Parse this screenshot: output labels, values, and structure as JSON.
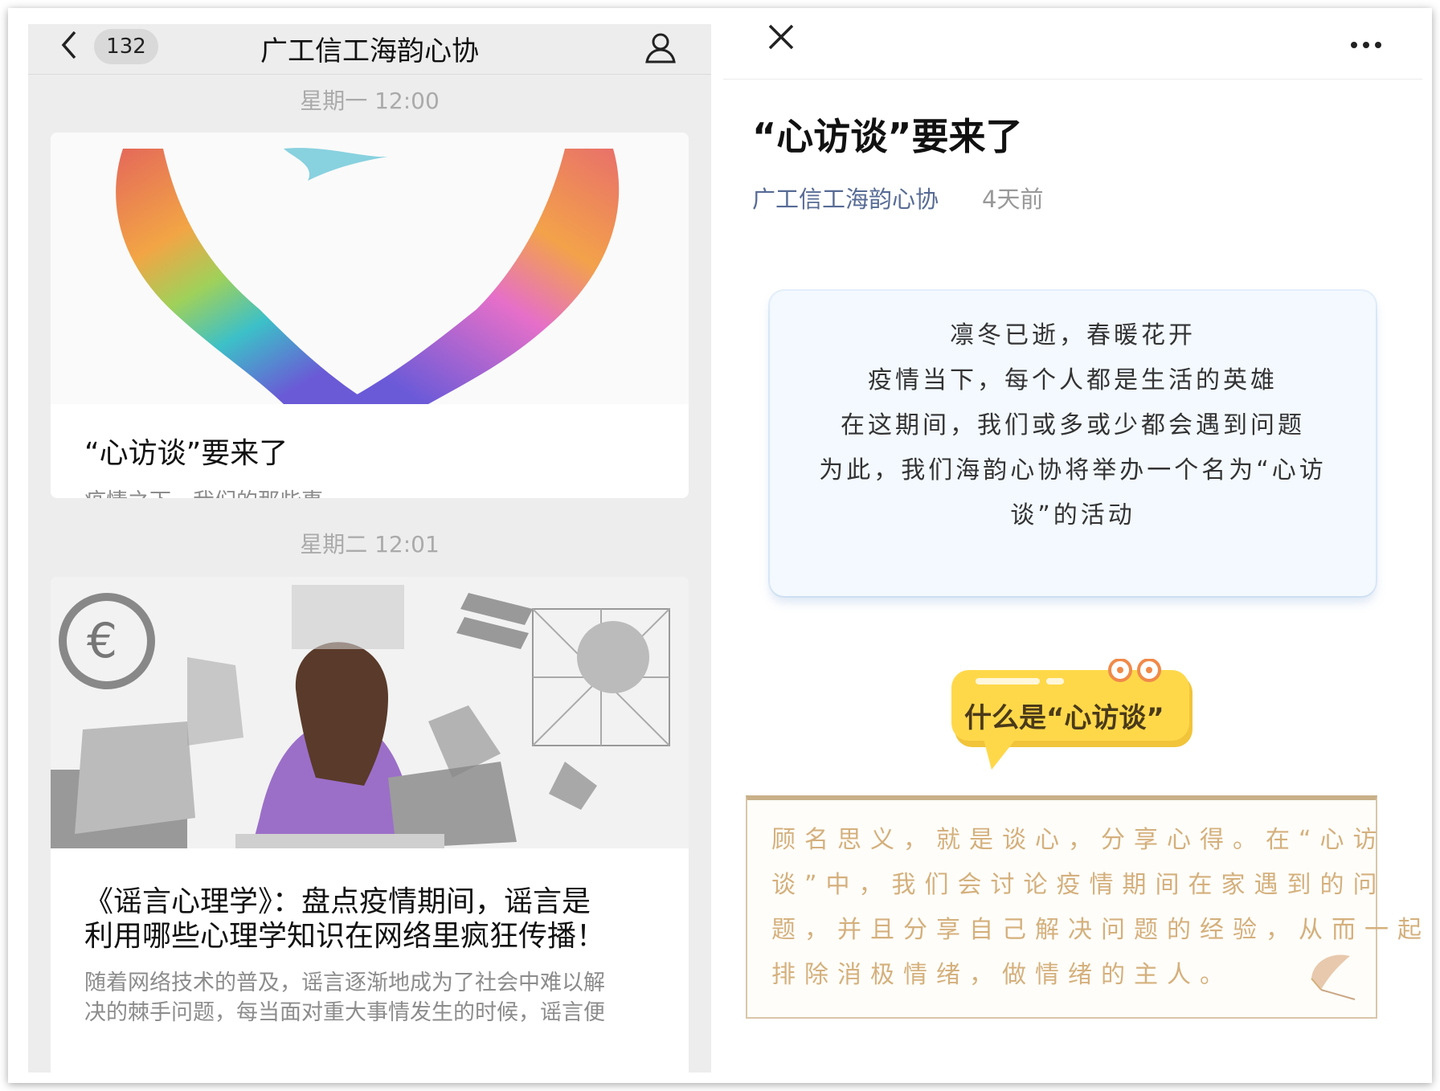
{
  "left": {
    "badge": "132",
    "title": "广工信工海韵心协",
    "time1": "星期一 12:00",
    "card1": {
      "title": "“心访谈”要来了",
      "desc": "疫情之下，我们的那些事"
    },
    "time2": "星期二 12:01",
    "card2": {
      "title_line1": "《谣言心理学》：盘点疫情期间，谣言是",
      "title_line2": "利用哪些心理学知识在网络里疯狂传播！",
      "desc_line1": "随着网络技术的普及，谣言逐渐地成为了社会中难以解",
      "desc_line2": "决的棘手问题，每当面对重大事情发生的时候，谣言便"
    }
  },
  "right": {
    "article_title": "“心访谈”要来了",
    "author": "广工信工海韵心协",
    "ago": "4天前",
    "intro": [
      "凛冬已逝，春暖花开",
      "疫情当下，每个人都是生活的英雄",
      "在这期间，我们或多或少都会遇到问题",
      "为此，我们海韵心协将举办一个名为“心访",
      "谈”的活动"
    ],
    "bubble": "什么是“心访谈”",
    "box": [
      "顾名思义，就是谈心，分享心得。在“心访",
      "谈”中，我们会讨论疫情期间在家遇到的问",
      "题，并且分享自己解决问题的经验，从而一起",
      "排除消极情绪，做情绪的主人。"
    ]
  },
  "colors": {
    "link": "#576b95",
    "bubble": "#ffd84a",
    "box_text": "#d4b07d"
  }
}
